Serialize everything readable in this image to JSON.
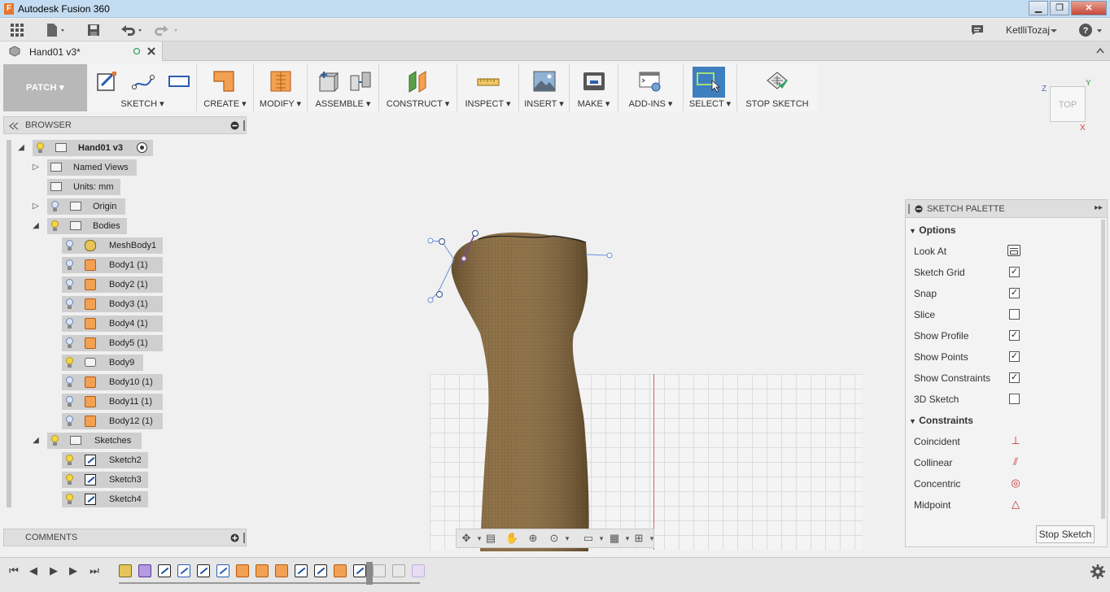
{
  "window": {
    "title": "Autodesk Fusion 360",
    "app_icon": "F",
    "min_glyph": "▁",
    "max_glyph": "❐",
    "close_glyph": "✕"
  },
  "qat": {
    "user_name": "KetlliTozaj",
    "icons": [
      "grid-icon",
      "file-icon",
      "save-icon",
      "undo-icon",
      "redo-icon",
      "comments-icon",
      "help-icon"
    ]
  },
  "doc_tab": {
    "name": "Hand01 v3*"
  },
  "toolbar": {
    "workspace": "PATCH",
    "groups": [
      {
        "label": "SKETCH"
      },
      {
        "label": "CREATE"
      },
      {
        "label": "MODIFY"
      },
      {
        "label": "ASSEMBLE"
      },
      {
        "label": "CONSTRUCT"
      },
      {
        "label": "INSPECT"
      },
      {
        "label": "INSERT"
      },
      {
        "label": "MAKE"
      },
      {
        "label": "ADD-INS"
      },
      {
        "label": "SELECT"
      },
      {
        "label": "STOP SKETCH"
      }
    ]
  },
  "browser": {
    "title": "BROWSER",
    "root": "Hand01 v3",
    "named_views": "Named Views",
    "units": "Units: mm",
    "origin": "Origin",
    "bodies": "Bodies",
    "body_items": [
      "MeshBody1",
      "Body1 (1)",
      "Body2 (1)",
      "Body3 (1)",
      "Body4 (1)",
      "Body5 (1)",
      "Body9",
      "Body10 (1)",
      "Body11 (1)",
      "Body12 (1)"
    ],
    "sketches": "Sketches",
    "sketch_items": [
      "Sketch2",
      "Sketch3",
      "Sketch4"
    ]
  },
  "comments": {
    "title": "COMMENTS"
  },
  "viewcube": {
    "face": "TOP",
    "axis_x": "X",
    "axis_y": "Y",
    "axis_z": "Z"
  },
  "palette": {
    "title": "SKETCH PALETTE",
    "options_title": "Options",
    "options": [
      {
        "label": "Look At",
        "type": "button"
      },
      {
        "label": "Sketch Grid",
        "checked": true
      },
      {
        "label": "Snap",
        "checked": true
      },
      {
        "label": "Slice",
        "checked": false
      },
      {
        "label": "Show Profile",
        "checked": true
      },
      {
        "label": "Show Points",
        "checked": true
      },
      {
        "label": "Show Constraints",
        "checked": true
      },
      {
        "label": "3D Sketch",
        "checked": false
      }
    ],
    "constraints_title": "Constraints",
    "constraints": [
      "Coincident",
      "Collinear",
      "Concentric",
      "Midpoint"
    ],
    "stop_button": "Stop Sketch"
  },
  "colors": {
    "body": "#8a6a3c",
    "accent": "#e8772e",
    "select_active": "#3f7fbf",
    "sketch_line": "#3366cc"
  }
}
